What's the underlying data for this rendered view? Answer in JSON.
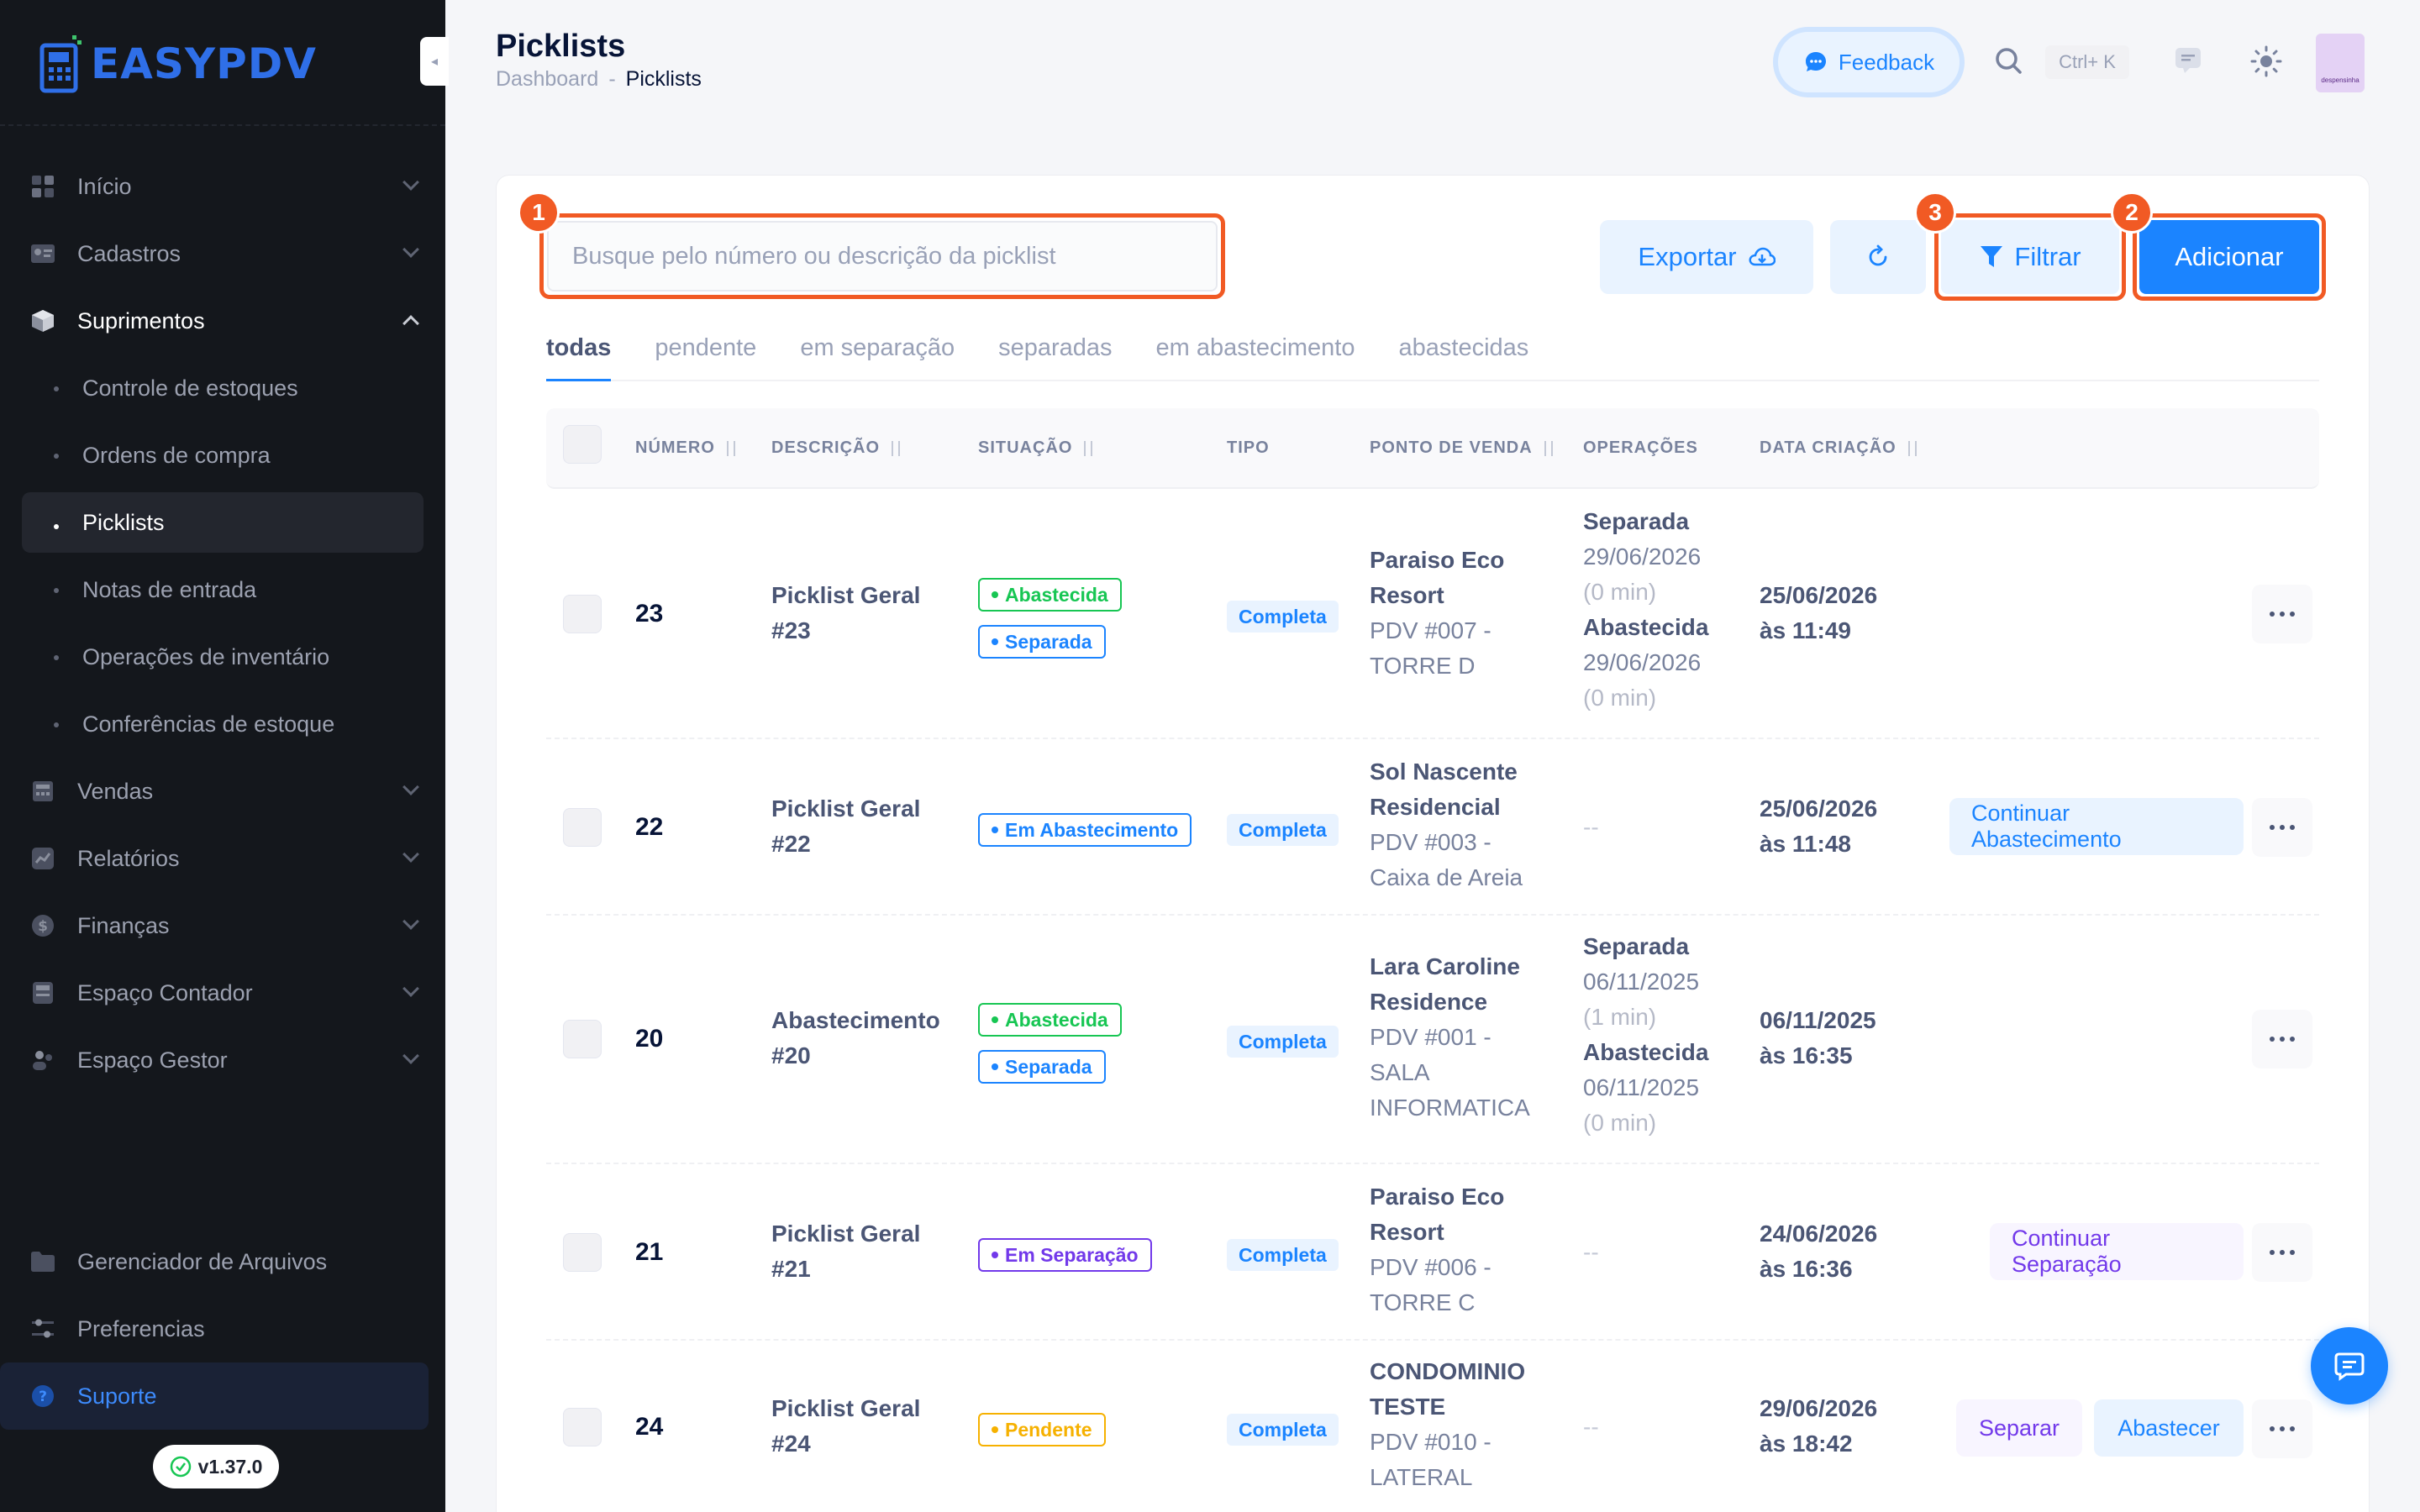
{
  "app": {
    "logo_text_easy": "EASY",
    "logo_text_pdv": "PDV",
    "version": "v1.37.0"
  },
  "sidebar": {
    "items": [
      {
        "label": "Início",
        "icon": "home-icon"
      },
      {
        "label": "Cadastros",
        "icon": "id-card-icon"
      },
      {
        "label": "Suprimentos",
        "icon": "box-icon",
        "open": true,
        "children": [
          {
            "label": "Controle de estoques"
          },
          {
            "label": "Ordens de compra"
          },
          {
            "label": "Picklists",
            "active": true
          },
          {
            "label": "Notas de entrada"
          },
          {
            "label": "Operações de inventário"
          },
          {
            "label": "Conferências de estoque"
          }
        ]
      },
      {
        "label": "Vendas",
        "icon": "cash-register-icon"
      },
      {
        "label": "Relatórios",
        "icon": "chart-icon"
      },
      {
        "label": "Finanças",
        "icon": "dollar-icon"
      },
      {
        "label": "Espaço Contador",
        "icon": "calculator-icon"
      },
      {
        "label": "Espaço Gestor",
        "icon": "people-icon"
      }
    ],
    "bottom": [
      {
        "label": "Gerenciador de Arquivos",
        "icon": "folder-icon"
      },
      {
        "label": "Preferencias",
        "icon": "sliders-icon"
      },
      {
        "label": "Suporte",
        "icon": "question-icon",
        "active": true
      }
    ]
  },
  "header": {
    "title": "Picklists",
    "breadcrumb": {
      "parent": "Dashboard",
      "separator": "-",
      "current": "Picklists"
    },
    "feedback_label": "Feedback",
    "search_shortcut": "Ctrl+ K",
    "avatar_text": "despensinha"
  },
  "toolbar": {
    "search_placeholder": "Busque pelo número ou descrição da picklist",
    "export_label": "Exportar",
    "filter_label": "Filtrar",
    "add_label": "Adicionar",
    "markers": {
      "search": "1",
      "add": "2",
      "filter": "3"
    }
  },
  "tabs": [
    {
      "label": "todas",
      "active": true
    },
    {
      "label": "pendente"
    },
    {
      "label": "em separação"
    },
    {
      "label": "separadas"
    },
    {
      "label": "em abastecimento"
    },
    {
      "label": "abastecidas"
    }
  ],
  "table": {
    "columns": {
      "numero": "NÚMERO",
      "descricao": "DESCRIÇÃO",
      "situacao": "SITUAÇÃO",
      "tipo": "TIPO",
      "ponto_venda": "PONTO DE VENDA",
      "operacoes": "OPERAÇÕES",
      "data_criacao": "DATA CRIAÇÃO"
    },
    "rows": [
      {
        "numero": "23",
        "desc1": "Picklist Geral",
        "desc2": "#23",
        "badges": [
          {
            "label": "Abastecida",
            "color": "green"
          },
          {
            "label": "Separada",
            "color": "blue"
          }
        ],
        "tipo": "Completa",
        "pdv_name1": "Paraiso Eco",
        "pdv_name2": "Resort",
        "pdv_code1": "PDV #007 -",
        "pdv_code2": "TORRE D",
        "ops": [
          {
            "label": "Separada",
            "date": "29/06/2026",
            "dur": "(0 min)"
          },
          {
            "label": "Abastecida",
            "date": "29/06/2026",
            "dur": "(0 min)"
          }
        ],
        "date1": "25/06/2026",
        "date2": "às 11:49",
        "actions": []
      },
      {
        "numero": "22",
        "desc1": "Picklist Geral",
        "desc2": "#22",
        "badges": [
          {
            "label": "Em Abastecimento",
            "color": "blue"
          }
        ],
        "tipo": "Completa",
        "pdv_name1": "Sol Nascente",
        "pdv_name2": "Residencial",
        "pdv_code1": "PDV #003 -",
        "pdv_code2": "Caixa de Areia",
        "ops_empty": "--",
        "date1": "25/06/2026",
        "date2": "às 11:48",
        "actions": [
          {
            "label": "Continuar Abastecimento",
            "color": "blue"
          }
        ]
      },
      {
        "numero": "20",
        "desc1": "Abastecimento",
        "desc2": "#20",
        "badges": [
          {
            "label": "Abastecida",
            "color": "green"
          },
          {
            "label": "Separada",
            "color": "blue"
          }
        ],
        "tipo": "Completa",
        "pdv_name1": "Lara Caroline",
        "pdv_name2": "Residence",
        "pdv_code1": "PDV #001 -",
        "pdv_code2": "SALA",
        "pdv_code3": "INFORMATICA",
        "ops": [
          {
            "label": "Separada",
            "date": "06/11/2025",
            "dur": "(1 min)"
          },
          {
            "label": "Abastecida",
            "date": "06/11/2025",
            "dur": "(0 min)"
          }
        ],
        "date1": "06/11/2025",
        "date2": "às 16:35",
        "actions": []
      },
      {
        "numero": "21",
        "desc1": "Picklist Geral",
        "desc2": "#21",
        "badges": [
          {
            "label": "Em Separação",
            "color": "purple"
          }
        ],
        "tipo": "Completa",
        "pdv_name1": "Paraiso Eco",
        "pdv_name2": "Resort",
        "pdv_code1": "PDV #006 -",
        "pdv_code2": "TORRE C",
        "ops_empty": "--",
        "date1": "24/06/2026",
        "date2": "às 16:36",
        "actions": [
          {
            "label": "Continuar Separação",
            "color": "purple"
          }
        ]
      },
      {
        "numero": "24",
        "desc1": "Picklist Geral",
        "desc2": "#24",
        "badges": [
          {
            "label": "Pendente",
            "color": "yellow"
          }
        ],
        "tipo": "Completa",
        "pdv_name1": "CONDOMINIO",
        "pdv_name2": "TESTE",
        "pdv_code1": "PDV #010 -",
        "pdv_code2": "LATERAL",
        "ops_empty": "--",
        "date1": "29/06/2026",
        "date2": "às 18:42",
        "actions": [
          {
            "label": "Separar",
            "color": "purple"
          },
          {
            "label": "Abastecer",
            "color": "blue"
          }
        ]
      }
    ]
  }
}
